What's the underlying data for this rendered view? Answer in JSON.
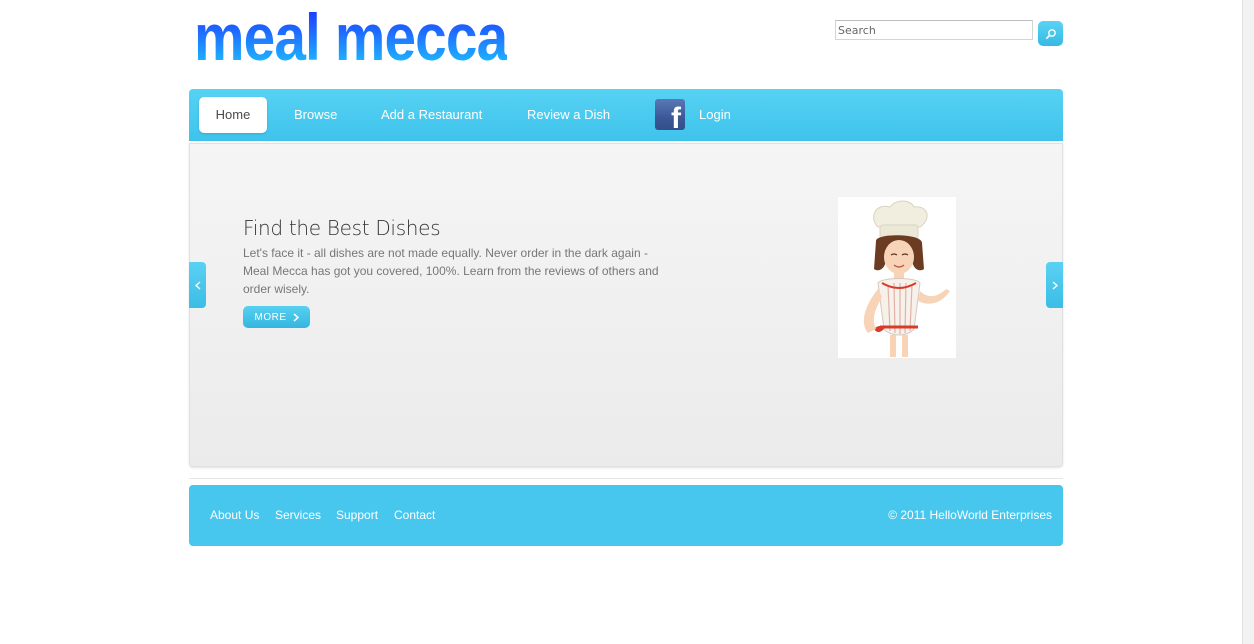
{
  "header": {
    "logo_text": "meal mecca",
    "search": {
      "placeholder": "Search",
      "value": ""
    }
  },
  "nav": {
    "items": [
      {
        "label": "Home",
        "active": true
      },
      {
        "label": "Browse"
      },
      {
        "label": "Add a Restaurant"
      },
      {
        "label": "Review a Dish"
      },
      {
        "label": "Login",
        "icon": "facebook-icon"
      }
    ]
  },
  "slider": {
    "title": "Find the Best Dishes",
    "text": "Let's face it - all dishes are not made equally. Never order in the dark again - Meal Mecca has got you covered, 100%. Learn from the reviews of others and order wisely.",
    "more_label": "MORE",
    "image": "chef-illustration",
    "prev_icon": "chevron-left-icon",
    "next_icon": "chevron-right-icon"
  },
  "footer": {
    "links": [
      "About Us",
      "Services",
      "Support",
      "Contact"
    ],
    "copyright": "© 2011 HelloWorld Enterprises"
  },
  "colors": {
    "accent": "#47c6ee",
    "logo_top": "#1a2bff",
    "logo_bottom": "#1ecbff",
    "facebook": "#3b5998"
  }
}
